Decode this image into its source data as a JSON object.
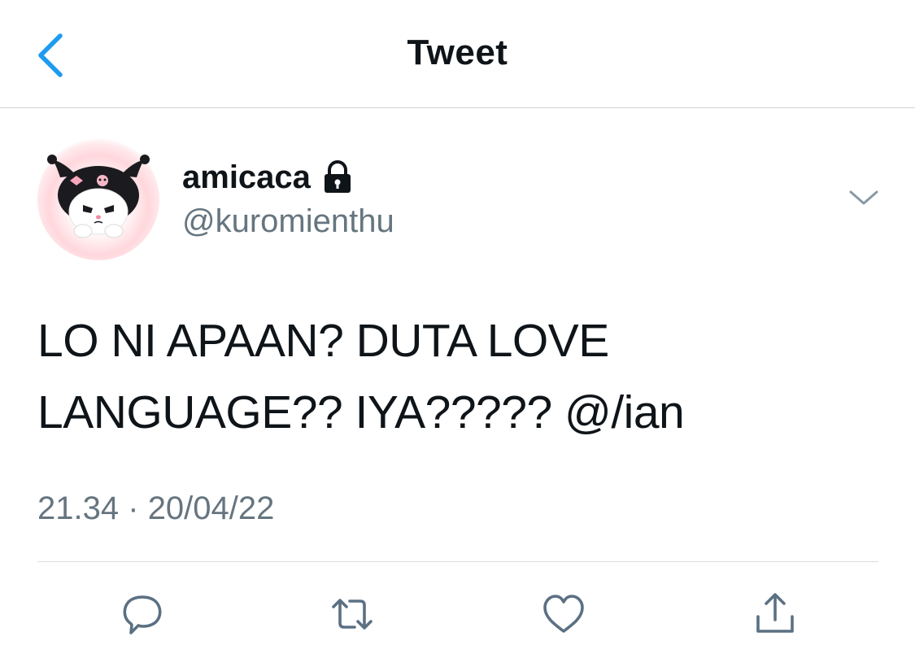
{
  "nav": {
    "back_icon": "chevron-left-icon",
    "title": "Tweet"
  },
  "colors": {
    "accent": "#1d9bf0",
    "text": "#0f1419",
    "secondary": "#66757f",
    "icon": "#5b7083"
  },
  "tweet": {
    "avatar_description": "kuromi-avatar",
    "display_name": "amicaca",
    "protected_icon": "lock-icon",
    "handle": "@kuromienthu",
    "menu_icon": "chevron-down-icon",
    "text_line1": "LO NI APAAN? DUTA LOVE",
    "text_line2": "LANGUAGE?? IYA????? @/ian",
    "time": "21.34",
    "separator": "·",
    "date": "20/04/22"
  },
  "actions": [
    {
      "name": "reply",
      "icon": "reply-icon"
    },
    {
      "name": "retweet",
      "icon": "retweet-icon"
    },
    {
      "name": "like",
      "icon": "heart-icon"
    },
    {
      "name": "share",
      "icon": "share-icon"
    }
  ]
}
